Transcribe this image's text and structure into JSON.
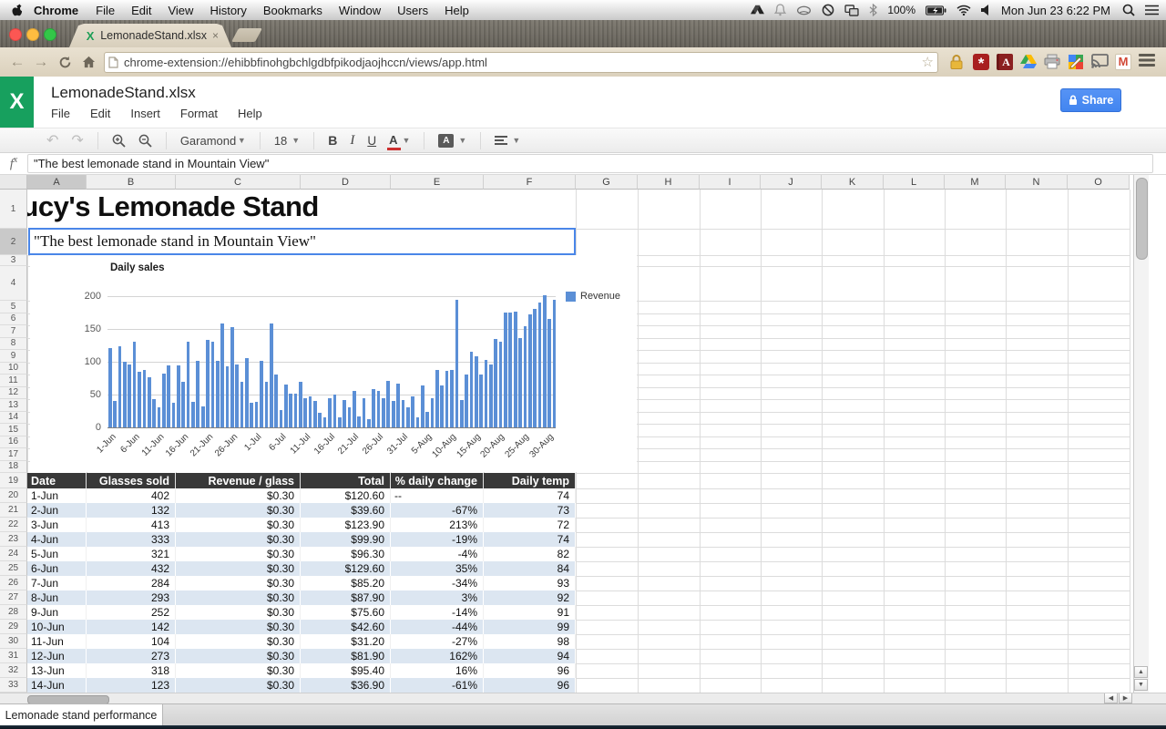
{
  "menu_bar": {
    "items": [
      "Chrome",
      "File",
      "Edit",
      "View",
      "History",
      "Bookmarks",
      "Window",
      "Users",
      "Help"
    ],
    "status": {
      "battery": "100%",
      "clock": "Mon Jun 23  6:22 PM"
    },
    "status_icons": [
      "drive-icon",
      "bell-icon",
      "eye-icon",
      "do-not-disturb-icon",
      "displays-icon",
      "bluetooth-icon",
      "battery-icon",
      "wifi-icon",
      "volume-icon",
      "spotlight-icon",
      "notification-center-icon"
    ]
  },
  "browser": {
    "tab_title": "LemonadeStand.xlsx",
    "tab_close": "×",
    "url": "chrome-extension://ehibbfinohgbchlgdbfpikodjaojhccn/views/app.html",
    "extensions": [
      "lock",
      "password-manager",
      "dictionary",
      "drive",
      "printer",
      "photo-editor",
      "cast",
      "gmail",
      "menu"
    ]
  },
  "app": {
    "logo_letter": "X",
    "title": "LemonadeStand.xlsx",
    "menus": [
      "File",
      "Edit",
      "Insert",
      "Format",
      "Help"
    ],
    "share_label": "Share"
  },
  "toolbar": {
    "font_name": "Garamond",
    "font_size": "18",
    "bold": "B",
    "italic": "I",
    "underline": "U",
    "text_color": "A",
    "fill_letter": "A"
  },
  "formula_bar": {
    "f": "f",
    "x": "x",
    "value": "\"The best lemonade stand in Mountain View\""
  },
  "spreadsheet": {
    "columns": [
      "A",
      "B",
      "C",
      "D",
      "E",
      "F",
      "G",
      "H",
      "I",
      "J",
      "K",
      "L",
      "M",
      "N",
      "O"
    ],
    "row_count": 33,
    "selected": {
      "column": "A",
      "row": 2
    },
    "cells": {
      "a1": "Lucy's Lemonade Stand",
      "a2": "\"The best lemonade stand in Mountain View\""
    }
  },
  "chart_data": {
    "type": "bar",
    "title": "Daily sales",
    "series": [
      {
        "name": "Revenue"
      }
    ],
    "ylim": [
      0,
      200
    ],
    "yticks": [
      0,
      50,
      100,
      150,
      200
    ],
    "x_tick_labels": [
      "1-Jun",
      "6-Jun",
      "11-Jun",
      "16-Jun",
      "21-Jun",
      "26-Jun",
      "1-Jul",
      "6-Jul",
      "11-Jul",
      "16-Jul",
      "21-Jul",
      "26-Jul",
      "31-Jul",
      "5-Aug",
      "10-Aug",
      "15-Aug",
      "20-Aug",
      "25-Aug",
      "30-Aug"
    ],
    "x_tick_interval": 5,
    "legend_position": "top-right",
    "grid": true,
    "values": [
      121,
      40,
      124,
      100,
      96,
      130,
      85,
      88,
      76,
      43,
      31,
      82,
      95,
      37,
      95,
      70,
      130,
      39,
      102,
      32,
      133,
      130,
      102,
      159,
      93,
      153,
      96,
      70,
      106,
      37,
      39,
      102,
      70,
      159,
      80,
      26,
      66,
      52,
      51,
      69,
      45,
      47,
      40,
      22,
      16,
      44,
      50,
      15,
      42,
      30,
      56,
      17,
      45,
      13,
      58,
      56,
      44,
      71,
      41,
      67,
      42,
      30,
      47,
      15,
      64,
      23,
      45,
      88,
      64,
      86,
      88,
      194,
      42,
      81,
      116,
      108,
      81,
      103,
      96,
      135,
      131,
      175,
      175,
      177,
      136,
      154,
      172,
      181,
      191,
      201,
      166,
      195
    ]
  },
  "table": {
    "headers": [
      "Date",
      "Glasses sold",
      "Revenue / glass",
      "Total",
      "% daily change",
      "Daily temp"
    ],
    "rows": [
      [
        "1-Jun",
        "402",
        "$0.30",
        "$120.60",
        "--",
        "74"
      ],
      [
        "2-Jun",
        "132",
        "$0.30",
        "$39.60",
        "-67%",
        "73"
      ],
      [
        "3-Jun",
        "413",
        "$0.30",
        "$123.90",
        "213%",
        "72"
      ],
      [
        "4-Jun",
        "333",
        "$0.30",
        "$99.90",
        "-19%",
        "74"
      ],
      [
        "5-Jun",
        "321",
        "$0.30",
        "$96.30",
        "-4%",
        "82"
      ],
      [
        "6-Jun",
        "432",
        "$0.30",
        "$129.60",
        "35%",
        "84"
      ],
      [
        "7-Jun",
        "284",
        "$0.30",
        "$85.20",
        "-34%",
        "93"
      ],
      [
        "8-Jun",
        "293",
        "$0.30",
        "$87.90",
        "3%",
        "92"
      ],
      [
        "9-Jun",
        "252",
        "$0.30",
        "$75.60",
        "-14%",
        "91"
      ],
      [
        "10-Jun",
        "142",
        "$0.30",
        "$42.60",
        "-44%",
        "99"
      ],
      [
        "11-Jun",
        "104",
        "$0.30",
        "$31.20",
        "-27%",
        "98"
      ],
      [
        "12-Jun",
        "273",
        "$0.30",
        "$81.90",
        "162%",
        "94"
      ],
      [
        "13-Jun",
        "318",
        "$0.30",
        "$95.40",
        "16%",
        "96"
      ],
      [
        "14-Jun",
        "123",
        "$0.30",
        "$36.90",
        "-61%",
        "96"
      ]
    ]
  },
  "sheet_tab": "Lemonade stand performance",
  "colors": {
    "accent_blue": "#4285f0",
    "selection_border": "#4a86e8",
    "bar_color": "#5b8fd6",
    "table_header_bg": "#383838",
    "alt_row_bg": "#dce6f1",
    "logo_green": "#17a05e"
  }
}
